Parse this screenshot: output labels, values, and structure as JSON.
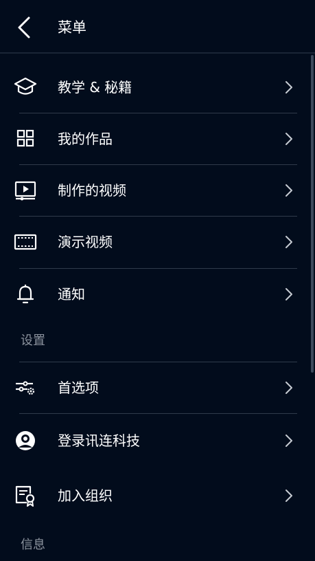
{
  "header": {
    "title": "菜单",
    "back_icon": "chevron-left-icon"
  },
  "menu": {
    "items": [
      {
        "label": "教学 & 秘籍",
        "icon": "graduation-cap-icon"
      },
      {
        "label": "我的作品",
        "icon": "grid-icon"
      },
      {
        "label": "制作的视频",
        "icon": "video-play-icon"
      },
      {
        "label": "演示视频",
        "icon": "film-icon"
      },
      {
        "label": "通知",
        "icon": "bell-icon"
      }
    ]
  },
  "settings": {
    "section_label": "设置",
    "items": [
      {
        "label": "首选项",
        "icon": "sliders-gear-icon"
      },
      {
        "label": "登录讯连科技",
        "icon": "user-circle-icon"
      },
      {
        "label": "加入组织",
        "icon": "certificate-icon"
      }
    ]
  },
  "info": {
    "section_label": "信息"
  },
  "colors": {
    "background": "#020c1c",
    "text": "#ffffff",
    "section_text": "#8c939e",
    "divider": "#303b4b"
  }
}
